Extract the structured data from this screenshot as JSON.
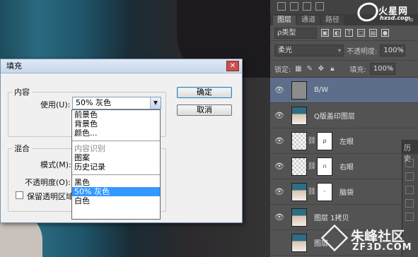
{
  "watermarks": {
    "top_brand": "火星网",
    "top_domain": "hxsd.com",
    "bottom_brand": "朱峰社区",
    "bottom_domain": "ZF3D.COM"
  },
  "layers_panel": {
    "tabs": [
      "图层",
      "通道",
      "路径"
    ],
    "filter_kind": "ρ类型",
    "blend_mode": "柔光",
    "opacity_label": "不透明度:",
    "opacity_value": "100%",
    "lock_label": "锁定:",
    "fill_label": "填充:",
    "fill_value": "100%",
    "layers": [
      {
        "name": "B/W",
        "selected": true,
        "thumb": "gray"
      },
      {
        "name": "Q版盖印图层",
        "thumb": "photo"
      },
      {
        "name": "左眼",
        "thumb": "check",
        "mask": "ρ"
      },
      {
        "name": "右眼",
        "thumb": "check",
        "mask": "∩"
      },
      {
        "name": "脑袋",
        "thumb": "photo",
        "mask": "ᵕ"
      },
      {
        "name": "图层 1拷贝",
        "thumb": "photo"
      },
      {
        "name": "图层",
        "thumb": "photo"
      }
    ]
  },
  "history_panel": {
    "title": "历史"
  },
  "fill_dialog": {
    "title": "填充",
    "close_glyph": "✕",
    "content_group": "内容",
    "use_label": "使用(U):",
    "use_value": "50% 灰色",
    "blend_group": "混合",
    "mode_label": "模式(M):",
    "opacity_label": "不透明度(O):",
    "preserve_label": "保留透明区域",
    "ok_label": "确定",
    "cancel_label": "取消",
    "options": [
      {
        "label": "前景色"
      },
      {
        "label": "背景色"
      },
      {
        "label": "颜色..."
      },
      {
        "sep": true
      },
      {
        "label": "内容识别",
        "disabled": true
      },
      {
        "label": "图案"
      },
      {
        "label": "历史记录"
      },
      {
        "sep": true
      },
      {
        "label": "黑色"
      },
      {
        "label": "50% 灰色",
        "highlighted": true
      },
      {
        "label": "白色"
      }
    ]
  }
}
